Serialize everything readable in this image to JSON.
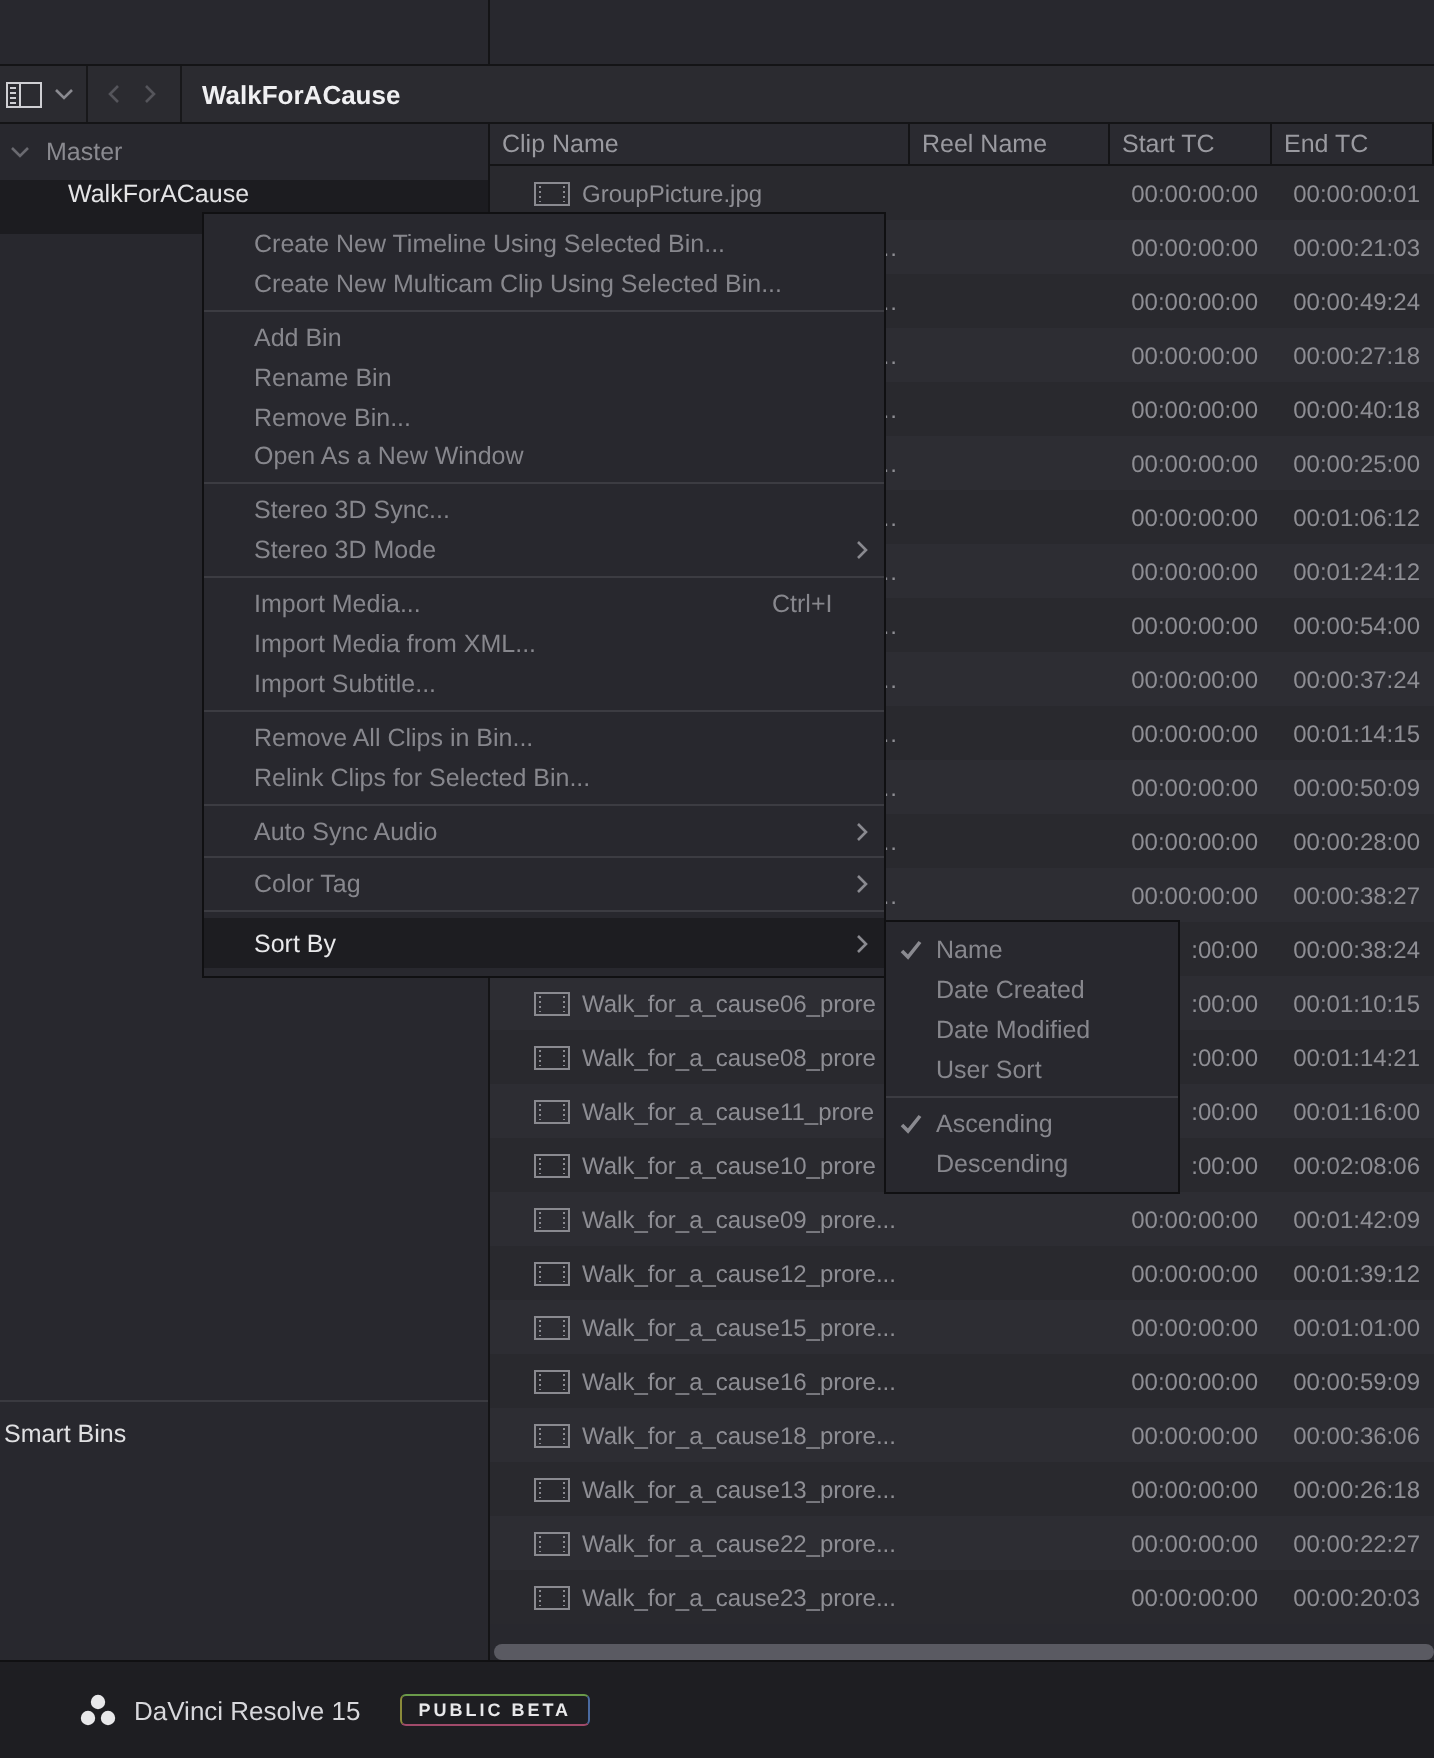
{
  "toolbar": {
    "bin_title": "WalkForACause"
  },
  "bins": {
    "root": {
      "label": "Master",
      "expanded": true,
      "children": [
        {
          "label": "WalkForACause",
          "selected": true
        }
      ]
    },
    "smart_bins_label": "Smart Bins"
  },
  "table": {
    "columns": [
      "Clip Name",
      "Reel Name",
      "Start TC",
      "End TC"
    ],
    "rows": [
      {
        "kind": "clip",
        "clip_name": "GroupPicture.jpg",
        "start_tc": "00:00:00:00",
        "end_tc": "00:00:00:01"
      },
      {
        "kind": "covered",
        "clip_name": "…",
        "start_tc": "00:00:00:00",
        "end_tc": "00:00:21:03"
      },
      {
        "kind": "covered",
        "clip_name": "…",
        "start_tc": "00:00:00:00",
        "end_tc": "00:00:49:24"
      },
      {
        "kind": "covered",
        "clip_name": "…",
        "start_tc": "00:00:00:00",
        "end_tc": "00:00:27:18"
      },
      {
        "kind": "covered",
        "clip_name": "…",
        "start_tc": "00:00:00:00",
        "end_tc": "00:00:40:18"
      },
      {
        "kind": "covered",
        "clip_name": "…",
        "start_tc": "00:00:00:00",
        "end_tc": "00:00:25:00"
      },
      {
        "kind": "covered",
        "clip_name": "…",
        "start_tc": "00:00:00:00",
        "end_tc": "00:01:06:12"
      },
      {
        "kind": "covered",
        "clip_name": "…",
        "start_tc": "00:00:00:00",
        "end_tc": "00:01:24:12"
      },
      {
        "kind": "covered",
        "clip_name": "…",
        "start_tc": "00:00:00:00",
        "end_tc": "00:00:54:00"
      },
      {
        "kind": "covered",
        "clip_name": "…",
        "start_tc": "00:00:00:00",
        "end_tc": "00:00:37:24"
      },
      {
        "kind": "covered",
        "clip_name": "…",
        "start_tc": "00:00:00:00",
        "end_tc": "00:01:14:15"
      },
      {
        "kind": "covered",
        "clip_name": "…",
        "start_tc": "00:00:00:00",
        "end_tc": "00:00:50:09"
      },
      {
        "kind": "covered",
        "clip_name": "…",
        "start_tc": "00:00:00:00",
        "end_tc": "00:00:28:00"
      },
      {
        "kind": "covered",
        "clip_name": "…",
        "start_tc": "00:00:00:00",
        "end_tc": "00:00:38:27"
      },
      {
        "kind": "covered",
        "start_tc": ":00:00",
        "end_tc": "00:00:38:24"
      },
      {
        "kind": "clip",
        "clip_name": "Walk_for_a_cause06_prore",
        "start_tc": ":00:00",
        "end_tc": "00:01:10:15"
      },
      {
        "kind": "clip",
        "clip_name": "Walk_for_a_cause08_prore",
        "start_tc": ":00:00",
        "end_tc": "00:01:14:21"
      },
      {
        "kind": "clip",
        "clip_name": "Walk_for_a_cause11_prore",
        "start_tc": ":00:00",
        "end_tc": "00:01:16:00"
      },
      {
        "kind": "clip",
        "clip_name": "Walk_for_a_cause10_prore",
        "start_tc": ":00:00",
        "end_tc": "00:02:08:06"
      },
      {
        "kind": "clip",
        "clip_name": "Walk_for_a_cause09_prore...",
        "start_tc": "00:00:00:00",
        "end_tc": "00:01:42:09"
      },
      {
        "kind": "clip",
        "clip_name": "Walk_for_a_cause12_prore...",
        "start_tc": "00:00:00:00",
        "end_tc": "00:01:39:12"
      },
      {
        "kind": "clip",
        "clip_name": "Walk_for_a_cause15_prore...",
        "start_tc": "00:00:00:00",
        "end_tc": "00:01:01:00"
      },
      {
        "kind": "clip",
        "clip_name": "Walk_for_a_cause16_prore...",
        "start_tc": "00:00:00:00",
        "end_tc": "00:00:59:09"
      },
      {
        "kind": "clip",
        "clip_name": "Walk_for_a_cause18_prore...",
        "start_tc": "00:00:00:00",
        "end_tc": "00:00:36:06"
      },
      {
        "kind": "clip",
        "clip_name": "Walk_for_a_cause13_prore...",
        "start_tc": "00:00:00:00",
        "end_tc": "00:00:26:18"
      },
      {
        "kind": "clip",
        "clip_name": "Walk_for_a_cause22_prore...",
        "start_tc": "00:00:00:00",
        "end_tc": "00:00:22:27"
      },
      {
        "kind": "clip",
        "clip_name": "Walk_for_a_cause23_prore...",
        "start_tc": "00:00:00:00",
        "end_tc": "00:00:20:03"
      }
    ]
  },
  "context_menu": {
    "groups": [
      [
        {
          "label": "Create New Timeline Using Selected Bin...",
          "submenu": false,
          "highlighted": false
        },
        {
          "label": "Create New Multicam Clip Using Selected Bin...",
          "submenu": false,
          "highlighted": false
        }
      ],
      [
        {
          "label": "Add Bin",
          "submenu": false,
          "highlighted": false
        },
        {
          "label": "Rename Bin",
          "submenu": false,
          "highlighted": false
        },
        {
          "label": "Remove Bin...",
          "submenu": false,
          "highlighted": false
        },
        {
          "label": "Open As a New Window",
          "submenu": false,
          "highlighted": false
        }
      ],
      [
        {
          "label": "Stereo 3D Sync...",
          "submenu": false,
          "highlighted": false
        },
        {
          "label": "Stereo 3D Mode",
          "submenu": true,
          "highlighted": false
        }
      ],
      [
        {
          "label": "Import Media...",
          "shortcut": "Ctrl+I",
          "submenu": false,
          "highlighted": false
        },
        {
          "label": "Import Media from XML...",
          "submenu": false,
          "highlighted": false
        },
        {
          "label": "Import Subtitle...",
          "submenu": false,
          "highlighted": false
        }
      ],
      [
        {
          "label": "Remove All Clips in Bin...",
          "submenu": false,
          "highlighted": false
        },
        {
          "label": "Relink Clips for Selected Bin...",
          "submenu": false,
          "highlighted": false
        }
      ],
      [
        {
          "label": "Auto Sync Audio",
          "submenu": true,
          "highlighted": false
        }
      ],
      [
        {
          "label": "Color Tag",
          "submenu": true,
          "highlighted": false
        }
      ],
      [
        {
          "label": "Sort By",
          "submenu": true,
          "highlighted": true
        }
      ]
    ]
  },
  "sort_submenu": {
    "groups": [
      [
        {
          "label": "Name",
          "checked": true
        },
        {
          "label": "Date Created",
          "checked": false
        },
        {
          "label": "Date Modified",
          "checked": false
        },
        {
          "label": "User Sort",
          "checked": false
        }
      ],
      [
        {
          "label": "Ascending",
          "checked": true
        },
        {
          "label": "Descending",
          "checked": false
        }
      ]
    ]
  },
  "footer": {
    "app_name": "DaVinci Resolve 15",
    "badge": "PUBLIC BETA"
  }
}
